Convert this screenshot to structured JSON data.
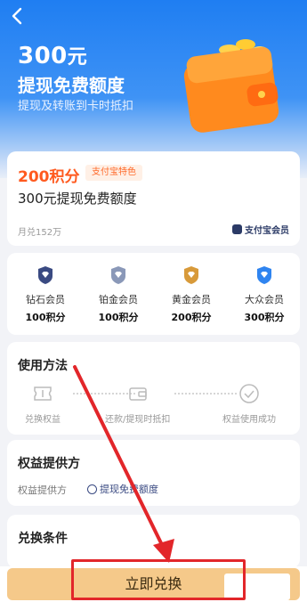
{
  "hero": {
    "amount": "300",
    "amount_unit": "元",
    "title": "提现免费额度",
    "subtitle": "提现及转账到卡时抵扣"
  },
  "offer": {
    "price": "200积分",
    "tag": "支付宝特色",
    "description": "300元提现免费额度",
    "monthly": "月兑152万",
    "brand": "支付宝会员"
  },
  "tiers": [
    {
      "name": "钻石会员",
      "points": "100积分",
      "color": "#3a4a82"
    },
    {
      "name": "铂金会员",
      "points": "100积分",
      "color": "#7a8aa8"
    },
    {
      "name": "黄金会员",
      "points": "200积分",
      "color": "#d89a3a"
    },
    {
      "name": "大众会员",
      "points": "300积分",
      "color": "#2f84f0"
    }
  ],
  "usage": {
    "title": "使用方法",
    "steps": [
      {
        "label": "兑换权益",
        "icon": "ticket-icon"
      },
      {
        "label": "还款/提现时抵扣",
        "icon": "wallet-icon"
      },
      {
        "label": "权益使用成功",
        "icon": "check-circle-icon"
      }
    ]
  },
  "provider": {
    "title": "权益提供方",
    "label": "权益提供方",
    "value": "提现免费额度"
  },
  "conditions": {
    "title": "兑换条件"
  },
  "bottom": {
    "redeem_label": "立即兑换"
  },
  "colors": {
    "brand_blue": "#1f7ef2",
    "price_orange": "#ff5a1f",
    "button_gold": "#f5c98a",
    "highlight_red": "#e2262a"
  }
}
